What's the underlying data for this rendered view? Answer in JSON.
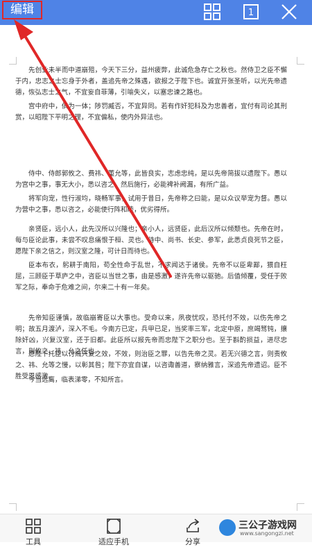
{
  "topbar": {
    "edit_label": "编辑",
    "grid_icon": "grid-icon",
    "page_icon": "single-page-icon",
    "page_number": "1",
    "close_icon": "close-icon",
    "accent_color": "#4f83e6",
    "highlight_color": "#e02727"
  },
  "document": {
    "paragraphs": [
      "先创业未半而中道崩殂，今天下三分，益州疲弊，此诚危急存亡之秋也。然侍卫之臣不懈于内，忠志之士忘身于外者，盖追先帝之殊遇，欲报之于陛下也。诚宜开张圣听，以光先帝遗德，恢弘志士之气，不宜妄自菲薄，引喻失义，以塞忠谏之路也。",
      "宫中府中，俱为一体；陟罚臧否，不宜异同。若有作奸犯科及为忠善者，宜付有司论其刑赏，以昭陛下平明之理，不宜偏私，使内外异法也。",
      "侍中、侍郎郭攸之、费祎、董允等，此皆良实，志虑忠纯，是以先帝简拔以遗陛下。愚以为宫中之事，事无大小，悉以咨之，然后施行，必能裨补阙漏，有所广益。",
      "将军向宠，性行淑均，晓畅军事，试用于昔日，先帝称之曰能，是以众议举宠为督。愚以为营中之事，悉以咨之，必能使行阵和睦，优劣得所。",
      "亲贤臣，远小人，此先汉所以兴隆也；亲小人，远贤臣，此后汉所以倾颓也。先帝在时，每与臣论此事，未尝不叹息痛恨于桓、灵也。侍中、尚书、长史、参军，此悉贞良死节之臣，愿陛下亲之信之，则汉室之隆，可计日而待也。",
      "臣本布衣，躬耕于南阳，苟全性命于乱世，不求闻达于诸侯。先帝不以臣卑鄙，猥自枉屈，三顾臣于草庐之中，咨臣以当世之事，由是感激，遂许先帝以驱驰。后值倾覆，受任于败军之际，奉命于危难之间，尔来二十有一年矣。",
      "先帝知臣谨慎，故临崩寄臣以大事也。受命以来，夙夜忧叹，恐托付不效，以伤先帝之明；故五月渡泸，深入不毛。今南方已定，兵甲已足，当奖率三军，北定中原，庶竭驽钝，攘除奸凶，兴复汉室，还于旧都。此臣所以报先帝而忠陛下之职分也。至于斟酌损益，进尽忠言，则攸之、祎、允之任也。",
      "愿陛下托臣以讨贼兴复之效，不效，则治臣之罪，以告先帝之灵。若无兴德之言，则责攸之、祎、允等之慢，以彰其咎；陛下亦宜自谋，以咨诹善道，察纳雅言，深追先帝遗诏。臣不胜受恩感激。",
      "今当远离，临表涕零，不知所言。"
    ]
  },
  "bottombar": {
    "tools_label": "工具",
    "tools_icon": "tools-grid-icon",
    "fit_label": "适应手机",
    "fit_icon": "fit-screen-icon",
    "share_label": "分享",
    "share_icon": "share-icon"
  },
  "watermark": {
    "logo_icon": "game-controller-logo-icon",
    "name": "三公子游戏网",
    "url": "www.sangongzi.net"
  }
}
